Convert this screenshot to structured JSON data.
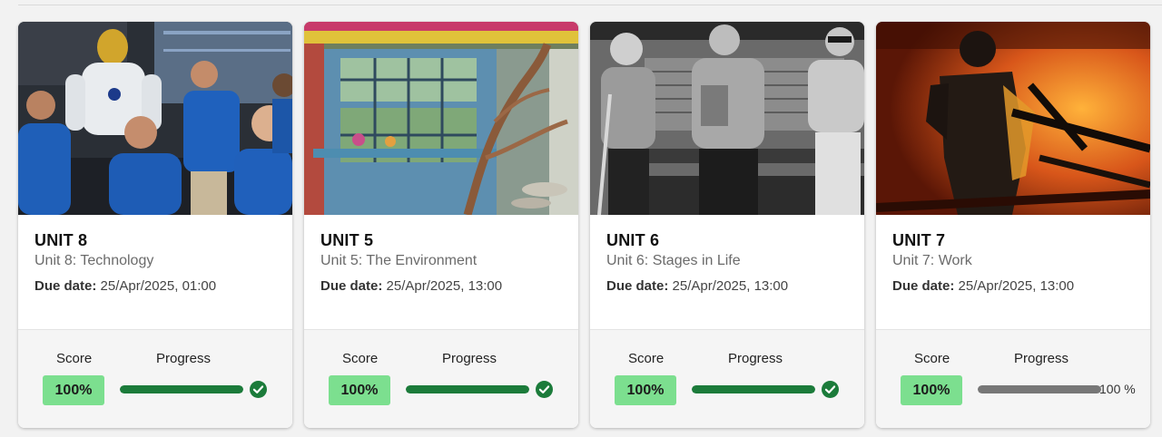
{
  "colors": {
    "progress_complete": "#1b7b3a",
    "progress_incomplete": "#777777",
    "score_badge": "#7cdf8f",
    "check": "#1b7b3a"
  },
  "labels": {
    "score": "Score",
    "progress": "Progress",
    "due_prefix": "Due date:"
  },
  "cards": [
    {
      "title": "UNIT 8",
      "subtitle": "Unit 8: Technology",
      "due_date": "25/Apr/2025, 01:00",
      "score": "100%",
      "progress": 1.0,
      "status_icon": "check-circle-icon",
      "image": "technology-robot-photo"
    },
    {
      "title": "UNIT 5",
      "subtitle": "Unit 5: The Environment",
      "due_date": "25/Apr/2025, 13:00",
      "score": "100%",
      "progress": 1.0,
      "status_icon": "check-circle-icon",
      "image": "environment-treehouse-photo"
    },
    {
      "title": "UNIT 6",
      "subtitle": "Unit 6: Stages in Life",
      "due_date": "25/Apr/2025, 13:00",
      "score": "100%",
      "progress": 1.0,
      "status_icon": "check-circle-icon",
      "image": "elderly-women-bench-photo"
    },
    {
      "title": "UNIT 7",
      "subtitle": "Unit 7: Work",
      "due_date": "25/Apr/2025, 13:00",
      "score": "100%",
      "progress": 1.0,
      "progress_text": "100 %",
      "image": "foundry-worker-photo"
    }
  ]
}
